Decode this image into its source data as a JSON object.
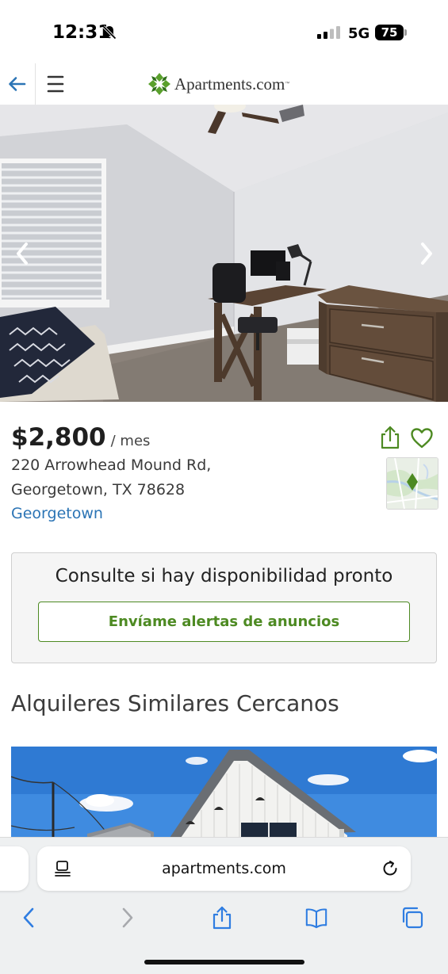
{
  "status_bar": {
    "time": "12:31",
    "network": "5G",
    "battery": "75"
  },
  "header": {
    "logo_text": "Apartments.com",
    "logo_tm": "™"
  },
  "listing": {
    "price": "$2,800",
    "price_unit": "/ mes",
    "address_line1": "220 Arrowhead Mound Rd,",
    "address_line2": "Georgetown, TX 78628",
    "neighborhood": "Georgetown"
  },
  "availability": {
    "title": "Consulte si hay disponibilidad pronto",
    "alert_button": "Envíame alertas de anuncios"
  },
  "similar": {
    "title": "Alquileres Similares Cercanos"
  },
  "browser": {
    "url": "apartments.com"
  },
  "colors": {
    "brand_green": "#4d8a22",
    "link_blue": "#2b74b5",
    "ios_blue": "#2f7de1"
  },
  "icons": [
    "bell-slash-icon",
    "signal-icon",
    "back-arrow-icon",
    "menu-icon",
    "share-icon",
    "heart-icon",
    "map-pin-icon",
    "reader-icon",
    "reload-icon",
    "chevron-left-icon",
    "chevron-right-icon",
    "bookmarks-icon",
    "tabs-icon"
  ]
}
